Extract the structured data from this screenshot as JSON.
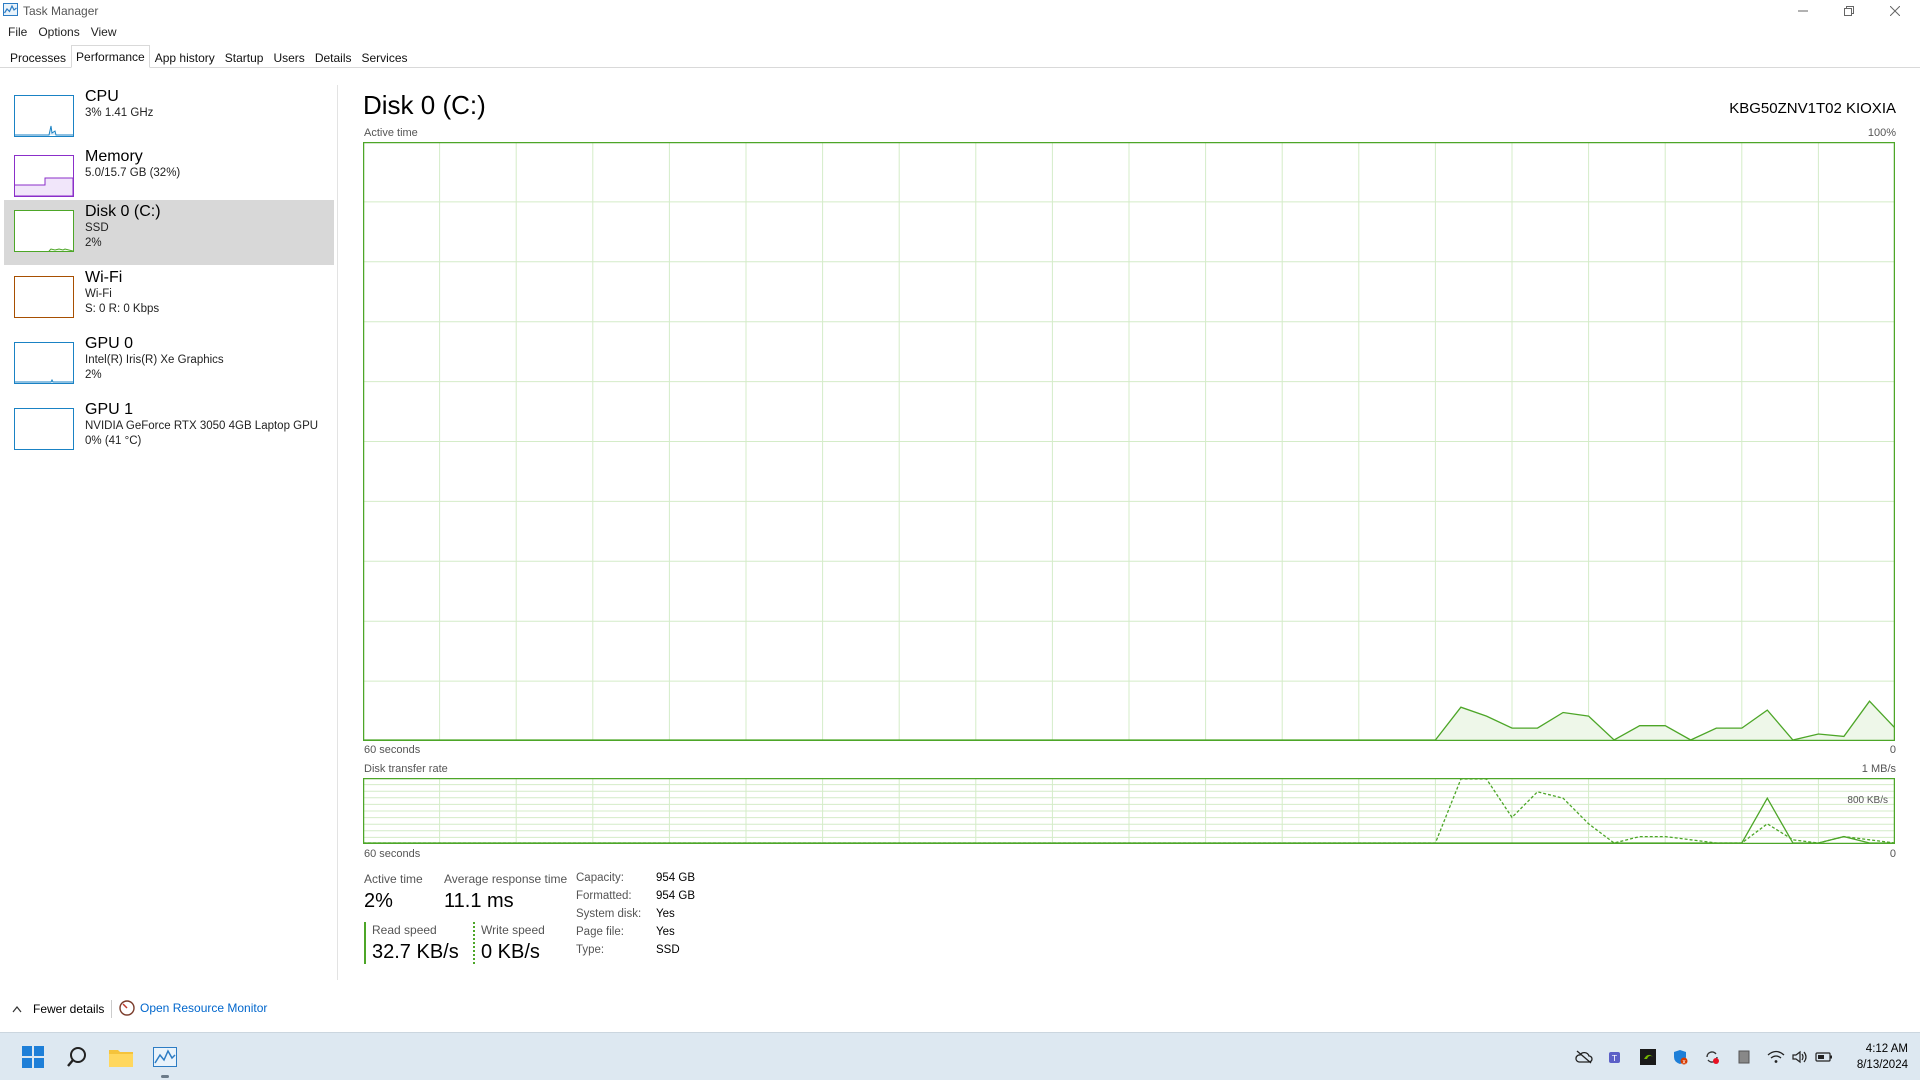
{
  "window": {
    "title": "Task Manager"
  },
  "menu": [
    "File",
    "Options",
    "View"
  ],
  "tabs": [
    "Processes",
    "Performance",
    "App history",
    "Startup",
    "Users",
    "Details",
    "Services"
  ],
  "active_tab": "Performance",
  "sidebar": {
    "items": [
      {
        "name": "CPU",
        "line1": "3%  1.41 GHz",
        "line2": "",
        "color": "#1a82c4",
        "selected": false
      },
      {
        "name": "Memory",
        "line1": "5.0/15.7 GB (32%)",
        "line2": "",
        "color": "#8b2fc9",
        "selected": false
      },
      {
        "name": "Disk 0 (C:)",
        "line1": "SSD",
        "line2": "2%",
        "color": "#4da628",
        "selected": true
      },
      {
        "name": "Wi-Fi",
        "line1": "Wi-Fi",
        "line2": "S: 0  R: 0 Kbps",
        "color": "#a74f01",
        "selected": false
      },
      {
        "name": "GPU 0",
        "line1": "Intel(R) Iris(R) Xe Graphics",
        "line2": "2%",
        "color": "#1a82c4",
        "selected": false
      },
      {
        "name": "GPU 1",
        "line1": "NVIDIA GeForce RTX 3050 4GB Laptop GPU",
        "line2": "0% (41 °C)",
        "color": "#1a82c4",
        "selected": false
      }
    ]
  },
  "main": {
    "title": "Disk 0 (C:)",
    "model": "KBG50ZNV1T02 KIOXIA",
    "active_graph": {
      "label": "Active time",
      "max_label": "100%",
      "time_label": "60 seconds",
      "min_label": "0"
    },
    "transfer_graph": {
      "label": "Disk transfer rate",
      "max_label": "1 MB/s",
      "mid_label": "800 KB/s",
      "time_label": "60 seconds",
      "min_label": "0"
    },
    "stats": {
      "active_time_label": "Active time",
      "active_time_value": "2%",
      "avg_response_label": "Average response time",
      "avg_response_value": "11.1 ms",
      "read_label": "Read speed",
      "read_value": "32.7 KB/s",
      "write_label": "Write speed",
      "write_value": "0 KB/s"
    },
    "info": [
      {
        "label": "Capacity:",
        "value": "954 GB"
      },
      {
        "label": "Formatted:",
        "value": "954 GB"
      },
      {
        "label": "System disk:",
        "value": "Yes"
      },
      {
        "label": "Page file:",
        "value": "Yes"
      },
      {
        "label": "Type:",
        "value": "SSD"
      }
    ]
  },
  "footer": {
    "fewer_details": "Fewer details",
    "resource_monitor": "Open Resource Monitor"
  },
  "taskbar": {
    "time": "4:12 AM",
    "date": "8/13/2024"
  },
  "colors": {
    "disk_green": "#4da628",
    "graph_fill": "#eef7e9",
    "grid": "#d4ecc8",
    "link": "#0066cc"
  },
  "chart_data": [
    {
      "type": "area",
      "title": "Active time",
      "xlabel": "60 seconds",
      "ylabel": "",
      "x": [
        60,
        58,
        56,
        54,
        52,
        50,
        48,
        46,
        44,
        42,
        40,
        38,
        36,
        34,
        32,
        30,
        28,
        26,
        24,
        22,
        20,
        18,
        17,
        16,
        15,
        14,
        13,
        12,
        11,
        10,
        9,
        8,
        7,
        6,
        5,
        4,
        3,
        2,
        1,
        0
      ],
      "series": [
        {
          "values": [
            0,
            0,
            0,
            0,
            0,
            0,
            0,
            0,
            0,
            0,
            0,
            0,
            0,
            0,
            0,
            0,
            0,
            0,
            0,
            0,
            0,
            0,
            5.5,
            4,
            2,
            2,
            4.6,
            4,
            0,
            2.4,
            2.4,
            0,
            2,
            2,
            5,
            0,
            1,
            0.6,
            6.5,
            2,
            0
          ]
        }
      ],
      "ylim": [
        0,
        100
      ],
      "xlim": [
        60,
        0
      ]
    },
    {
      "type": "line",
      "title": "Disk transfer rate",
      "xlabel": "60 seconds",
      "ylabel": "",
      "x": [
        60,
        18,
        17,
        16,
        15,
        14,
        13,
        12,
        11,
        10,
        9,
        8,
        7,
        6,
        5,
        4,
        3,
        2,
        1,
        0
      ],
      "series": [
        {
          "values": [
            0,
            0,
            1000,
            1000,
            400,
            800,
            700,
            300,
            0,
            100,
            100,
            50,
            0,
            0,
            300,
            50,
            0,
            100,
            50,
            0
          ]
        },
        {
          "values": [
            0,
            0,
            0,
            0,
            0,
            0,
            0,
            0,
            0,
            0,
            0,
            0,
            0,
            0,
            700,
            0,
            0,
            100,
            0,
            0
          ]
        }
      ],
      "ylim": [
        0,
        1000
      ]
    }
  ]
}
